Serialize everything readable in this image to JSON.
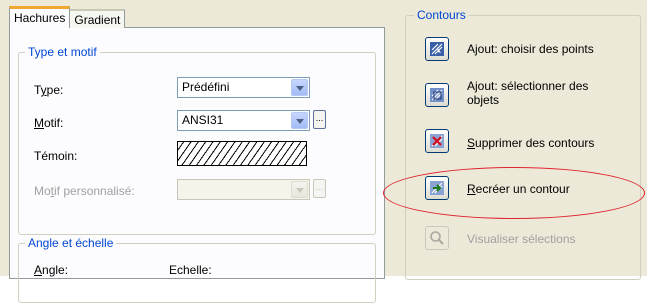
{
  "tabs": [
    {
      "label": "Hachures",
      "active": true
    },
    {
      "label": "Gradient",
      "active": false
    }
  ],
  "type_motif": {
    "title": "Type et motif",
    "type_label_u": "y",
    "type_label_pre": "T",
    "type_label_post": "pe:",
    "type_value": "Prédéfini",
    "motif_label_pre": "",
    "motif_label_u": "M",
    "motif_label_post": "otif:",
    "motif_value": "ANSI31",
    "motif_ellipsis": "...",
    "temoin_label": "Témoin:",
    "perso_label_pre": "Mo",
    "perso_label_u": "t",
    "perso_label_post": "if personnalisé:",
    "perso_ellipsis": "..."
  },
  "angle_echelle": {
    "title": "Angle et échelle",
    "angle_pre": "",
    "angle_u": "A",
    "angle_post": "ngle:",
    "echelle_label": "Echelle:"
  },
  "contours": {
    "title": "Contours",
    "items": [
      {
        "label": "Ajout: choisir des points",
        "icon": "pick-points-icon",
        "enabled": true
      },
      {
        "label_line1": "Ajout: sélectionner des",
        "label_line2": "objets",
        "icon": "select-objects-icon",
        "enabled": true
      },
      {
        "label_pre": "",
        "label_u": "S",
        "label_post": "upprimer des contours",
        "icon": "remove-boundary-icon",
        "enabled": true
      },
      {
        "label_pre": "",
        "label_u": "R",
        "label_post": "ecréer un contour",
        "icon": "recreate-boundary-icon",
        "enabled": true
      },
      {
        "label": "Visualiser sélections",
        "icon": "view-selections-icon",
        "enabled": false
      }
    ]
  },
  "highlight_color": "#e0242f",
  "accent_color": "#0046d5"
}
